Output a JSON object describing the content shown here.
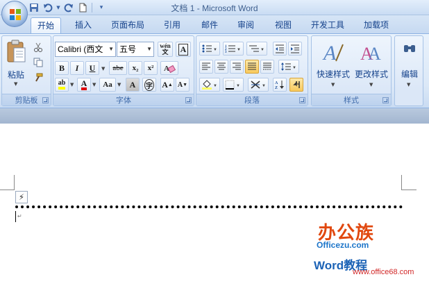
{
  "window": {
    "title": "文档 1 - Microsoft Word",
    "qat_items": [
      "save-icon",
      "undo-icon",
      "redo-icon",
      "new-document-icon",
      "customize-dropdown-icon"
    ]
  },
  "tabs": [
    {
      "label": "开始",
      "active": true
    },
    {
      "label": "插入"
    },
    {
      "label": "页面布局"
    },
    {
      "label": "引用"
    },
    {
      "label": "邮件"
    },
    {
      "label": "审阅"
    },
    {
      "label": "视图"
    },
    {
      "label": "开发工具"
    },
    {
      "label": "加载项"
    }
  ],
  "ribbon": {
    "clipboard": {
      "paste_label": "粘贴",
      "group_label": "剪贴板"
    },
    "font": {
      "font_name": "Calibri (西文",
      "font_size": "五号",
      "phonetic_glyph": "wén\n文",
      "border_glyph": "A",
      "bold": "B",
      "italic": "I",
      "underline": "U",
      "strike": "abe",
      "subscript": "x₂",
      "superscript": "x²",
      "highlight": "ab",
      "font_color": "A",
      "change_case": "Aa",
      "char_shading": "A",
      "enclose": "字",
      "grow": "A",
      "shrink": "A",
      "group_label": "字体"
    },
    "paragraph": {
      "group_label": "段落"
    },
    "styles": {
      "quick_styles": "快速样式",
      "change_styles": "更改样式",
      "group_label": "样式"
    },
    "editing": {
      "label": "编辑"
    }
  },
  "document": {
    "paragraph_mark": "↵",
    "autocorrect_glyph": "⚡"
  },
  "watermark": {
    "brand": "办公族",
    "site": "Officezu.com",
    "tutorial": "Word教程",
    "url": "www.office68.com"
  },
  "colors": {
    "ribbon_text": "#15428b",
    "highlight": "#f8c95c",
    "font_color_red": "#e00000",
    "highlight_yellow": "#ffff00",
    "brand_orange": "#e1480f",
    "brand_blue": "#1c75c9"
  }
}
